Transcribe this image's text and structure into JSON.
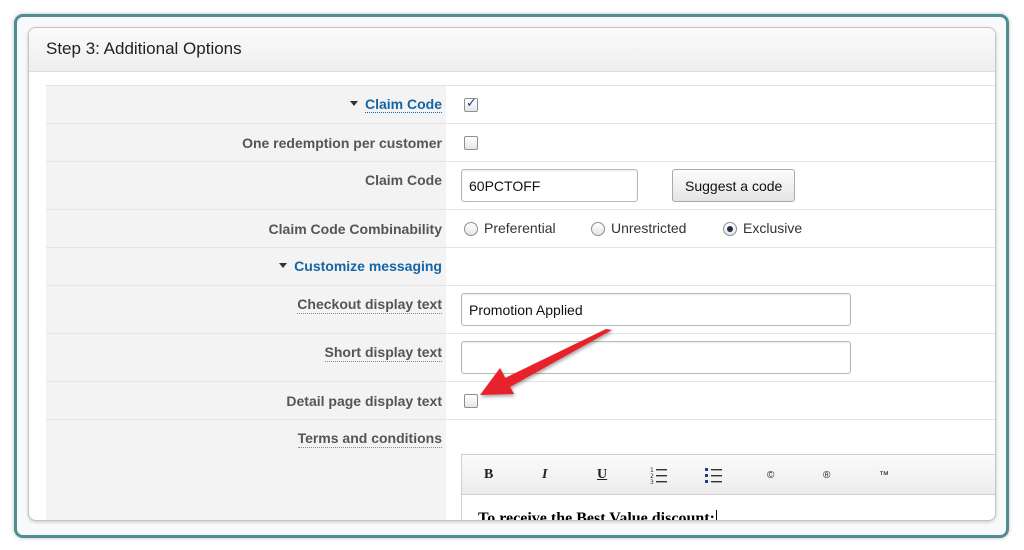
{
  "panel": {
    "title": "Step 3: Additional Options"
  },
  "rows": {
    "claim_code_section": {
      "label": "Claim Code",
      "checked": true
    },
    "one_redemption": {
      "label": "One redemption per customer",
      "checked": false
    },
    "claim_code": {
      "label": "Claim Code",
      "value": "60PCTOFF",
      "button": "Suggest a code"
    },
    "combinability": {
      "label": "Claim Code Combinability",
      "options": [
        "Preferential",
        "Unrestricted",
        "Exclusive"
      ],
      "selected": "Exclusive"
    },
    "customize_messaging": {
      "label": "Customize messaging"
    },
    "checkout_text": {
      "label": "Checkout display text",
      "value": "Promotion Applied"
    },
    "short_text": {
      "label": "Short display text",
      "value": ""
    },
    "detail_text": {
      "label": "Detail page display text",
      "checked": false
    },
    "terms": {
      "label": "Terms and conditions",
      "toolbar": {
        "bold": "B",
        "italic": "I",
        "underline": "U",
        "copyright": "©",
        "registered": "®",
        "trademark": "™"
      },
      "content": "To receive the Best Value discount:"
    }
  },
  "colors": {
    "frame": "#4f8c93",
    "link": "#1565a6",
    "arrow": "#e8232a"
  }
}
